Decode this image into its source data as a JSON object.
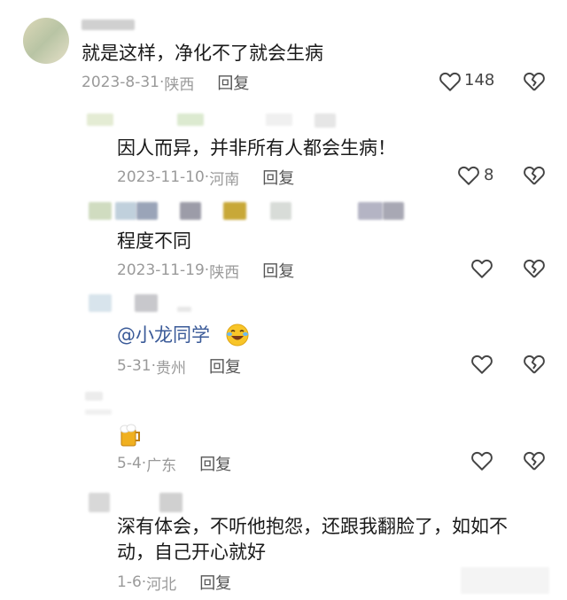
{
  "comments": [
    {
      "text": "就是这样，净化不了就会生病",
      "date": "2023-8-31",
      "location": "陕西",
      "reply": "回复",
      "likes": "148"
    },
    {
      "text": "因人而异，并非所有人都会生病！",
      "date": "2023-11-10",
      "location": "河南",
      "reply": "回复",
      "likes": "8"
    },
    {
      "text": "程度不同",
      "date": "2023-11-19",
      "location": "陕西",
      "reply": "回复",
      "likes": ""
    },
    {
      "mention": "@小龙同学",
      "date": "5-31",
      "location": "贵州",
      "reply": "回复",
      "likes": ""
    },
    {
      "text": "",
      "date": "5-4",
      "location": "广东",
      "reply": "回复",
      "likes": ""
    },
    {
      "text": "深有体会，不听他抱怨，还跟我翻脸了，如如不",
      "text2": "动，自己开心就好",
      "date": "1-6",
      "location": "河北",
      "reply": "回复",
      "likes": ""
    }
  ],
  "icons": {
    "like": "heart-outline-icon",
    "dislike": "broken-heart-icon",
    "emoji_laugh": "laughing-tears-emoji",
    "emoji_beer": "beer-mug-emoji"
  }
}
